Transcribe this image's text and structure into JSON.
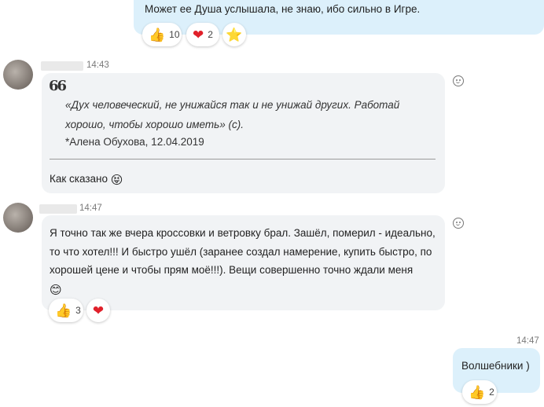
{
  "messages": [
    {
      "id": "out1",
      "text": "Может ее Душа услышала, не знаю, ибо сильно в Игре.",
      "reactions": [
        {
          "icon": "thumbs-up",
          "glyph": "👍",
          "count": "10"
        },
        {
          "icon": "heart",
          "glyph": "❤",
          "count": "2"
        },
        {
          "icon": "star",
          "glyph": "⭐",
          "count": ""
        }
      ]
    },
    {
      "id": "in1",
      "time": "14:43",
      "quote_mark": "66",
      "quote": "«Дух человеческий, не унижайся так и не унижай других. Работай хорошо, чтобы хорошо иметь»  (с).",
      "quote_author": "*Алена Обухова, 12.04.2019",
      "text": "Как сказано",
      "emoji": "😝"
    },
    {
      "id": "in2",
      "time": "14:47",
      "text": "Я точно так же вчера кроссовки и ветровку брал. Зашёл, померил - идеально, то что хотел!!! И быстро ушёл (заранее создал намерение, купить быстро, по хорошей цене и чтобы прям моё!!!). Вещи совершенно точно ждали меня",
      "emoji": "😊",
      "reactions": [
        {
          "icon": "thumbs-up",
          "glyph": "👍",
          "count": "3"
        },
        {
          "icon": "heart",
          "glyph": "❤",
          "count": ""
        }
      ]
    },
    {
      "id": "out2",
      "time": "14:47",
      "text": "Волшебники )",
      "reactions": [
        {
          "icon": "thumbs-up",
          "glyph": "👍",
          "count": "2"
        }
      ]
    }
  ],
  "colors": {
    "outgoing_bubble": "#dcf0fb",
    "incoming_bubble": "#f1f3f5",
    "heart": "#e0202a"
  }
}
